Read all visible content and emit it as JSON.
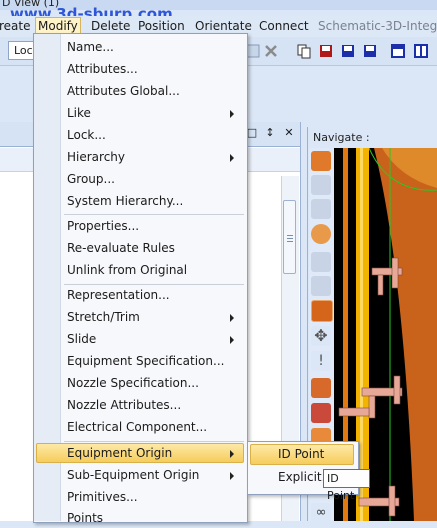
{
  "window": {
    "title": "D View (1)"
  },
  "watermark": "www.3d-sburp.com",
  "menubar": {
    "items": [
      "reate",
      "Modify",
      "Delete",
      "Position",
      "Orientate",
      "Connect",
      "Schematic-3D-Integ"
    ]
  },
  "toolbar": {
    "combo_value": "Loc"
  },
  "left_panel": {
    "pin_glyph": "↕",
    "close_glyph": "✕",
    "box_glyph": "□"
  },
  "navigate": {
    "title": "Navigate :"
  },
  "context_menu": {
    "items": [
      {
        "label": "Name...",
        "submenu": false
      },
      {
        "label": "Attributes...",
        "submenu": false
      },
      {
        "label": "Attributes Global...",
        "submenu": false
      },
      {
        "label": "Like",
        "submenu": true
      },
      {
        "label": "Lock...",
        "submenu": false
      },
      {
        "label": "Hierarchy",
        "submenu": true
      },
      {
        "label": "Group...",
        "submenu": false
      },
      {
        "label": "System Hierarchy...",
        "submenu": false
      },
      {
        "label": "Properties...",
        "submenu": false
      },
      {
        "label": "Re-evaluate Rules",
        "submenu": false
      },
      {
        "label": "Unlink from Original",
        "submenu": false
      },
      {
        "label": "Representation...",
        "submenu": false
      },
      {
        "label": "Stretch/Trim",
        "submenu": true
      },
      {
        "label": "Slide",
        "submenu": true
      },
      {
        "label": "Equipment Specification...",
        "submenu": false
      },
      {
        "label": "Nozzle Specification...",
        "submenu": false
      },
      {
        "label": "Nozzle Attributes...",
        "submenu": false
      },
      {
        "label": "Electrical Component...",
        "submenu": false
      },
      {
        "label": "Equipment Origin",
        "submenu": true,
        "highlighted": true
      },
      {
        "label": "Sub-Equipment Origin",
        "submenu": true
      },
      {
        "label": "Primitives...",
        "submenu": false
      },
      {
        "label": "Points",
        "submenu": false
      }
    ]
  },
  "submenu": {
    "items": [
      {
        "label": "ID Point",
        "highlighted": true
      },
      {
        "label": "Explicit..."
      }
    ]
  },
  "tooltip": {
    "text": "ID Point"
  },
  "colors": {
    "highlight": "#f6cd5c",
    "pipe": "#f2b400",
    "steel": "#e8a898",
    "vessel": "#d9771e"
  }
}
